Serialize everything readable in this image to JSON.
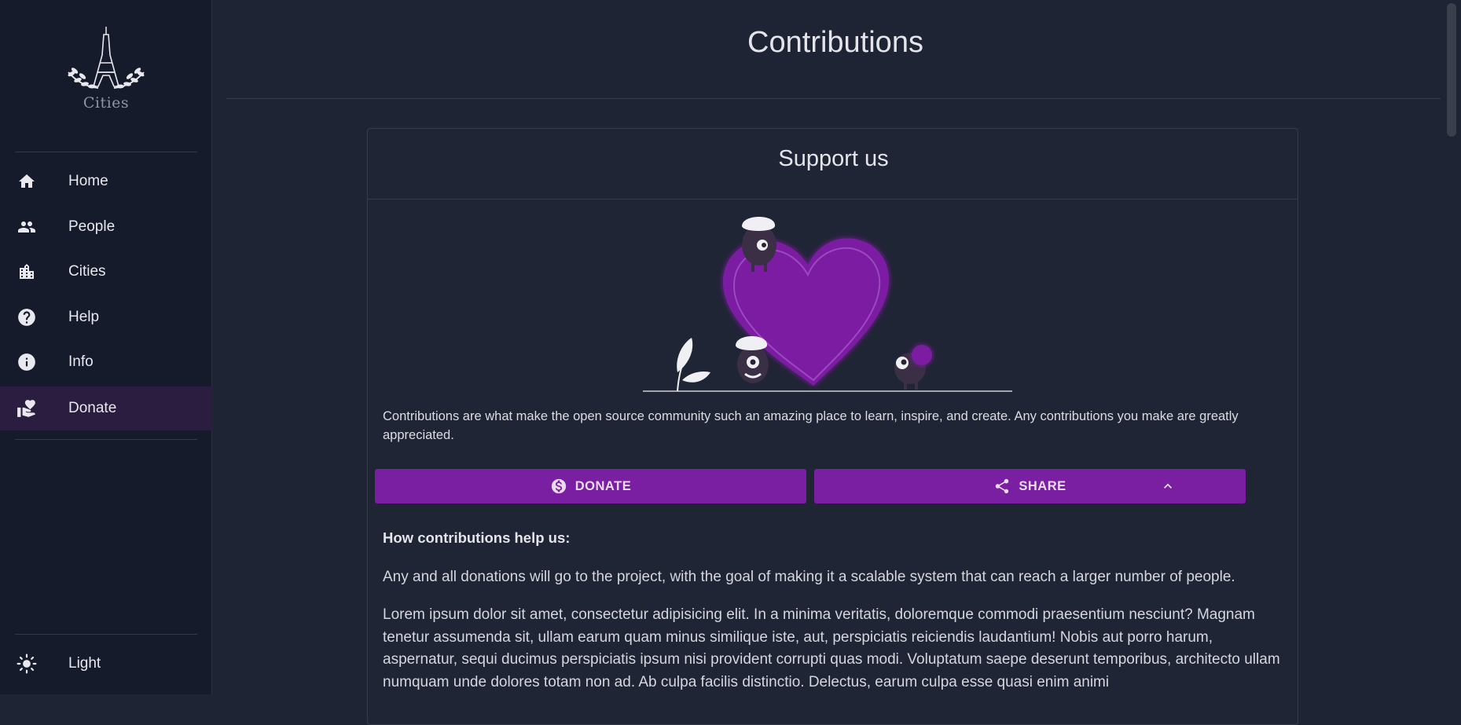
{
  "brand": {
    "name": "Cities"
  },
  "nav": {
    "items": [
      {
        "label": "Home",
        "icon": "home-icon"
      },
      {
        "label": "People",
        "icon": "people-icon"
      },
      {
        "label": "Cities",
        "icon": "building-icon"
      },
      {
        "label": "Help",
        "icon": "help-icon"
      },
      {
        "label": "Info",
        "icon": "info-icon"
      },
      {
        "label": "Donate",
        "icon": "donate-hand-heart-icon",
        "active": true
      }
    ],
    "theme_toggle": {
      "label": "Light",
      "icon": "sun-icon"
    }
  },
  "page": {
    "title": "Contributions"
  },
  "card": {
    "title": "Support us",
    "intro": "Contributions are what make the open source community such an amazing place to learn, inspire, and create. Any contributions you make are greatly appreciated.",
    "donate_label": "DONATE",
    "share_label": "SHARE",
    "help_heading": "How contributions help us:",
    "para1": "Any and all donations will go to the project, with the goal of making it a scalable system that can reach a larger number of people.",
    "para2": "Lorem ipsum dolor sit amet, consectetur adipisicing elit. In a minima veritatis, doloremque commodi praesentium nesciunt? Magnam tenetur assumenda sit, ullam earum quam minus similique iste, aut, perspiciatis reiciendis laudantium! Nobis aut porro harum, aspernatur, sequi ducimus perspiciatis ipsum nisi provident corrupti quas modi. Voluptatum saepe deserunt temporibus, architecto ullam numquam unde dolores totam non ad. Ab culpa facilis distinctio. Delectus, earum culpa esse quasi enim animi"
  },
  "colors": {
    "accent": "#7b1fa2",
    "sidebar_bg": "#151b2b",
    "main_bg": "#1e2433",
    "active_bg": "#2a1d40"
  }
}
